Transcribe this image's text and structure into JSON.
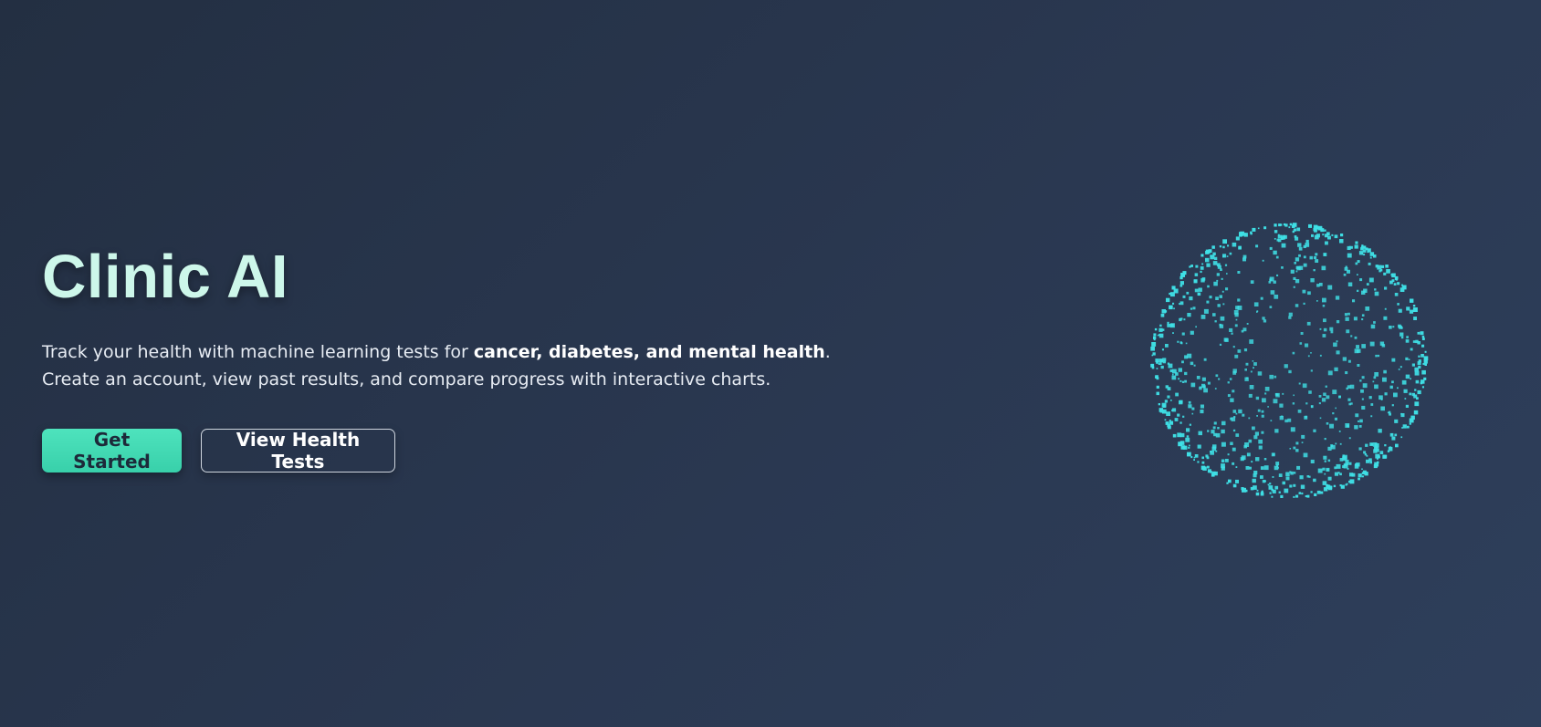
{
  "hero": {
    "title": "Clinic AI",
    "description": {
      "line1_prefix": "Track your health with machine learning tests for ",
      "line1_bold": "cancer, diabetes, and mental health",
      "line1_suffix": ".",
      "line2": "Create an account, view past results, and compare progress with interactive charts."
    },
    "buttons": {
      "primary_label": "Get Started",
      "secondary_label": "View Health Tests"
    }
  },
  "visual": {
    "name": "particle-globe",
    "particle_color": "#3fe0e6"
  },
  "colors": {
    "background_start": "#232f42",
    "background_end": "#2e3f5b",
    "title": "#cdf7ea",
    "accent": "#45dab5"
  }
}
